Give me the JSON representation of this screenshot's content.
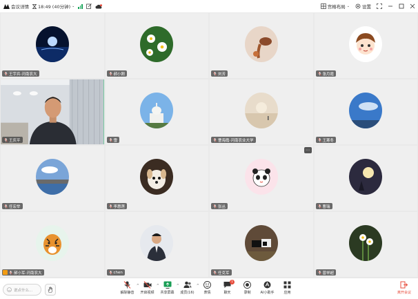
{
  "titlebar": {
    "meeting_info": "会议详情",
    "time": "18:49 (40分钟)",
    "layout": "宫格布局",
    "settings": "设置"
  },
  "tiles": [
    {
      "name": "王宇兵-河南农大",
      "kind": "avatar",
      "scene": "moon-sea"
    },
    {
      "name": "郝小刚",
      "kind": "avatar",
      "scene": "daisies"
    },
    {
      "name": "刘芳",
      "kind": "avatar",
      "scene": "horse"
    },
    {
      "name": "张月霞",
      "kind": "avatar",
      "scene": "cartoon-boy"
    },
    {
      "name": "王庆平",
      "kind": "video",
      "scene": "office"
    },
    {
      "name": "雪",
      "kind": "avatar",
      "scene": "capitol"
    },
    {
      "name": "曹海霞-河南农业大学",
      "kind": "avatar",
      "scene": "fog-lake"
    },
    {
      "name": "王寒冬",
      "kind": "avatar",
      "scene": "blue-sky"
    },
    {
      "name": "任宏举",
      "kind": "avatar",
      "scene": "lake-sky"
    },
    {
      "name": "李惠莲",
      "kind": "avatar",
      "scene": "dog"
    },
    {
      "name": "张丛",
      "kind": "avatar",
      "scene": "panda"
    },
    {
      "name": "曹瑞",
      "kind": "avatar",
      "scene": "moon-night"
    },
    {
      "name": "郝小军-河南农大",
      "kind": "avatar",
      "scene": "tiger",
      "host": true
    },
    {
      "name": "chen",
      "kind": "avatar",
      "scene": "man"
    },
    {
      "name": "任克军",
      "kind": "avatar",
      "scene": "cows"
    },
    {
      "name": "曾祥超",
      "kind": "avatar",
      "scene": "narcissus"
    }
  ],
  "toolbar": {
    "chat_placeholder": "说点什么...",
    "tools": [
      {
        "label": "解除静音",
        "icon": "mic-muted-icon",
        "caret": true
      },
      {
        "label": "开启视频",
        "icon": "camera-off-icon",
        "caret": true
      },
      {
        "label": "共享屏幕",
        "icon": "share-screen-icon",
        "caret": true
      },
      {
        "label": "成员(16)",
        "icon": "members-icon",
        "caret": true
      },
      {
        "label": "表情",
        "icon": "emoji-icon"
      },
      {
        "label": "聊天",
        "icon": "chat-icon",
        "badge": "1"
      },
      {
        "label": "录制",
        "icon": "record-icon"
      },
      {
        "label": "AI小助手",
        "icon": "ai-assistant-icon"
      },
      {
        "label": "应用",
        "icon": "apps-icon"
      }
    ],
    "leave_label": "离开会议"
  },
  "colors": {
    "active_border": "#2ecc71",
    "leave": "#e74c3c",
    "signal": "#19a55a"
  }
}
